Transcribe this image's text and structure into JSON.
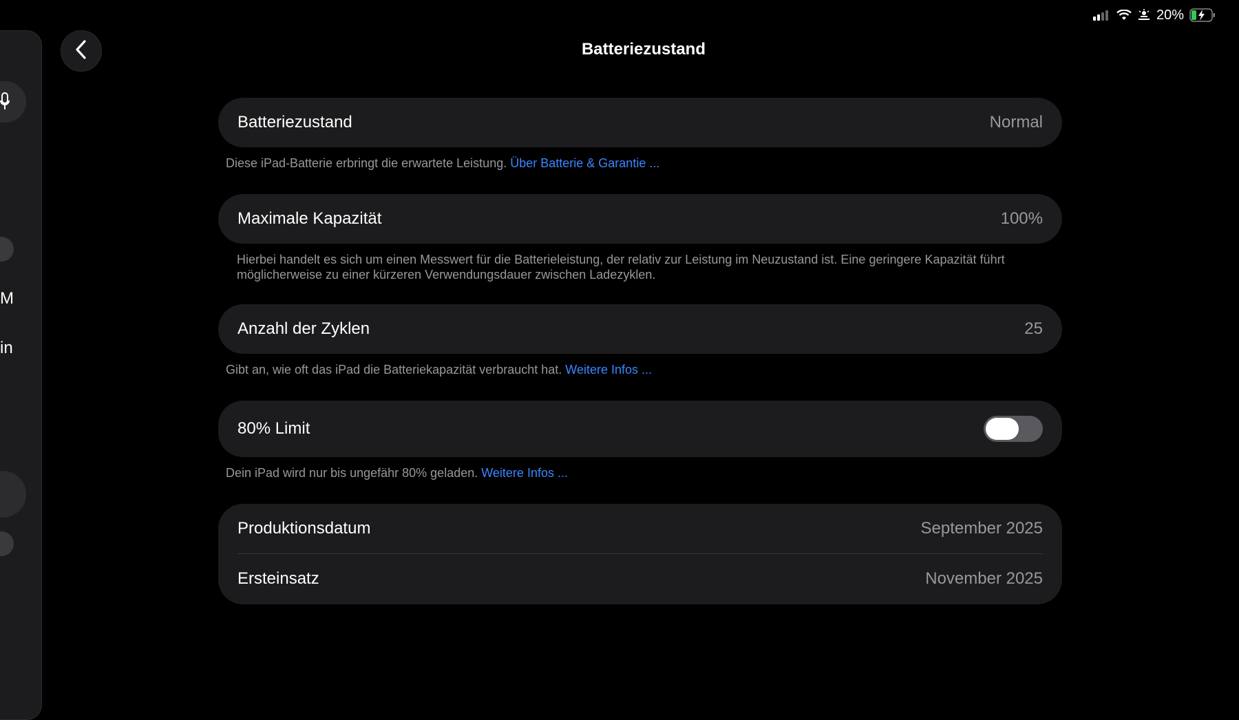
{
  "status_bar": {
    "battery_percent": "20%",
    "icons": [
      "signal-icon",
      "wifi-icon",
      "hotspot-icon",
      "battery-charging-icon"
    ]
  },
  "sidebar": {
    "fragments": [
      "M",
      "in"
    ]
  },
  "header": {
    "title": "Batteriezustand",
    "back_icon": "chevron-left-icon"
  },
  "battery_health": {
    "label": "Batteriezustand",
    "value": "Normal",
    "footer_text": "Diese iPad-Batterie erbringt die erwartete Leistung.",
    "footer_link": "Über Batterie & Garantie ..."
  },
  "max_capacity": {
    "label": "Maximale Kapazität",
    "value": "100%",
    "footer_text": "Hierbei handelt es sich um einen Messwert für die Batterieleistung, der relativ zur Leistung im Neuzustand ist. Eine geringere Kapazität führt möglicherweise zu einer kürzeren Verwendungsdauer zwischen Ladezyklen."
  },
  "cycle_count": {
    "label": "Anzahl der Zyklen",
    "value": "25",
    "footer_text": "Gibt an, wie oft das iPad die Batteriekapazität verbraucht hat.",
    "footer_link": "Weitere Infos ..."
  },
  "limit_80": {
    "label": "80% Limit",
    "enabled": false,
    "footer_text": "Dein iPad wird nur bis ungefähr 80% geladen.",
    "footer_link": "Weitere Infos ..."
  },
  "dates": {
    "production_label": "Produktionsdatum",
    "production_value": "September 2025",
    "first_use_label": "Ersteinsatz",
    "first_use_value": "November 2025"
  },
  "colors": {
    "background": "#000000",
    "cell": "#1c1c1e",
    "secondary_text": "#98989d",
    "link": "#3a86ff"
  }
}
